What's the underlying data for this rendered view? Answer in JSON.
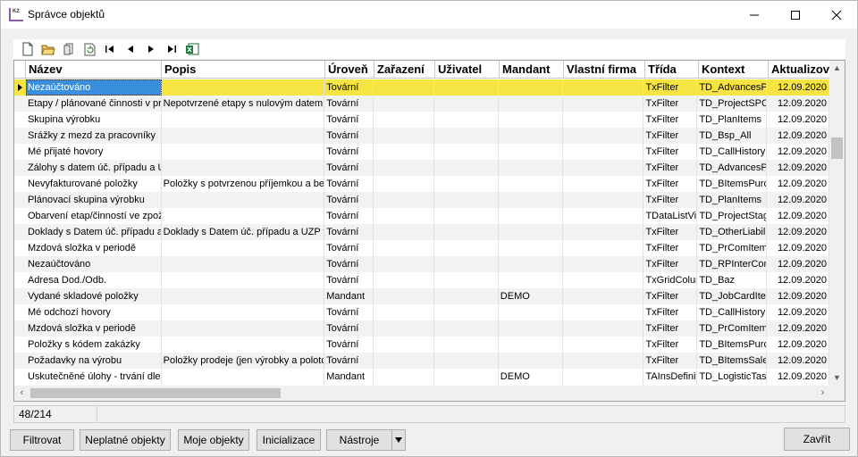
{
  "window": {
    "title": "Správce objektů",
    "icon_label": "K2"
  },
  "toolbar": {
    "items": [
      "new-icon",
      "open-icon",
      "copy-icon",
      "refresh-icon",
      "first-icon",
      "prev-icon",
      "next-icon",
      "last-icon",
      "excel-icon"
    ]
  },
  "grid": {
    "columns": [
      "Název",
      "Popis",
      "Úroveň",
      "Zařazení",
      "Uživatel",
      "Mandant",
      "Vlastní firma",
      "Třída",
      "Kontext",
      "Aktualizov"
    ],
    "rows": [
      [
        "Nezaúčtováno",
        "",
        "Tovární",
        "",
        "",
        "",
        "",
        "TxFilter",
        "TD_AdvancesP",
        "12.09.2020"
      ],
      [
        "Etapy / plánované činnosti v pr",
        "Nepotvrzené etapy s nulovým datem",
        "Tovární",
        "",
        "",
        "",
        "",
        "TxFilter",
        "TD_ProjectSPC",
        "12.09.2020"
      ],
      [
        "Skupina výrobku",
        "",
        "Tovární",
        "",
        "",
        "",
        "",
        "TxFilter",
        "TD_PlanItems",
        "12.09.2020"
      ],
      [
        "Srážky z mezd za pracovníky",
        "",
        "Tovární",
        "",
        "",
        "",
        "",
        "TxFilter",
        "TD_Bsp_All",
        "12.09.2020"
      ],
      [
        "Mé přijaté hovory",
        "",
        "Tovární",
        "",
        "",
        "",
        "",
        "TxFilter",
        "TD_CallHistory",
        "12.09.2020"
      ],
      [
        "Zálohy s datem úč. případu a U",
        "",
        "Tovární",
        "",
        "",
        "",
        "",
        "TxFilter",
        "TD_AdvancesP",
        "12.09.2020"
      ],
      [
        "Nevyfakturované položky",
        "Položky s potvrzenou příjemkou a bez",
        "Tovární",
        "",
        "",
        "",
        "",
        "TxFilter",
        "TD_BItemsPurc",
        "12.09.2020"
      ],
      [
        "Plánovací skupina výrobku",
        "",
        "Tovární",
        "",
        "",
        "",
        "",
        "TxFilter",
        "TD_PlanItems",
        "12.09.2020"
      ],
      [
        "Obarvení etap/činností ve zpož",
        "",
        "Tovární",
        "",
        "",
        "",
        "",
        "TDataListVie",
        "TD_ProjectStag",
        "12.09.2020"
      ],
      [
        "Doklady s Datem úč. případu a",
        "Doklady s Datem úč. případu a UZP v",
        "Tovární",
        "",
        "",
        "",
        "",
        "TxFilter",
        "TD_OtherLiabili",
        "12.09.2020"
      ],
      [
        "Mzdová složka v periodě",
        "",
        "Tovární",
        "",
        "",
        "",
        "",
        "TxFilter",
        "TD_PrComItem",
        "12.09.2020"
      ],
      [
        "Nezaúčtováno",
        "",
        "Tovární",
        "",
        "",
        "",
        "",
        "TxFilter",
        "TD_RPInterCor",
        "12.09.2020"
      ],
      [
        "Adresa Dod./Odb.",
        "",
        "Tovární",
        "",
        "",
        "",
        "",
        "TxGridColum",
        "TD_Baz",
        "12.09.2020"
      ],
      [
        "Vydané skladové položky",
        "",
        "Mandant",
        "",
        "",
        "DEMO",
        "",
        "TxFilter",
        "TD_JobCardIte",
        "12.09.2020"
      ],
      [
        "Mé odchozí hovory",
        "",
        "Tovární",
        "",
        "",
        "",
        "",
        "TxFilter",
        "TD_CallHistory",
        "12.09.2020"
      ],
      [
        "Mzdová složka v periodě",
        "",
        "Tovární",
        "",
        "",
        "",
        "",
        "TxFilter",
        "TD_PrComItem",
        "12.09.2020"
      ],
      [
        "Položky s kódem zakázky",
        "",
        "Tovární",
        "",
        "",
        "",
        "",
        "TxFilter",
        "TD_BItemsPurc",
        "12.09.2020"
      ],
      [
        "Požadavky na výrobu",
        "Položky prodeje (jen výrobky a polotc",
        "Tovární",
        "",
        "",
        "",
        "",
        "TxFilter",
        "TD_BItemsSale",
        "12.09.2020"
      ],
      [
        "Uskutečněné úlohy - trvání dle",
        "",
        "Mandant",
        "",
        "",
        "DEMO",
        "",
        "TAInsDefinit",
        "TD_LogisticTas",
        "12.09.2020"
      ]
    ]
  },
  "status": {
    "count": "48/214"
  },
  "buttons": {
    "filter": "Filtrovat",
    "invalid": "Neplatné objekty",
    "mine": "Moje objekty",
    "init": "Inicializace",
    "tools": "Nástroje",
    "close": "Zavřít"
  },
  "colors": {
    "selected_row": "#f5e441",
    "selected_cell": "#3a8fdc"
  }
}
